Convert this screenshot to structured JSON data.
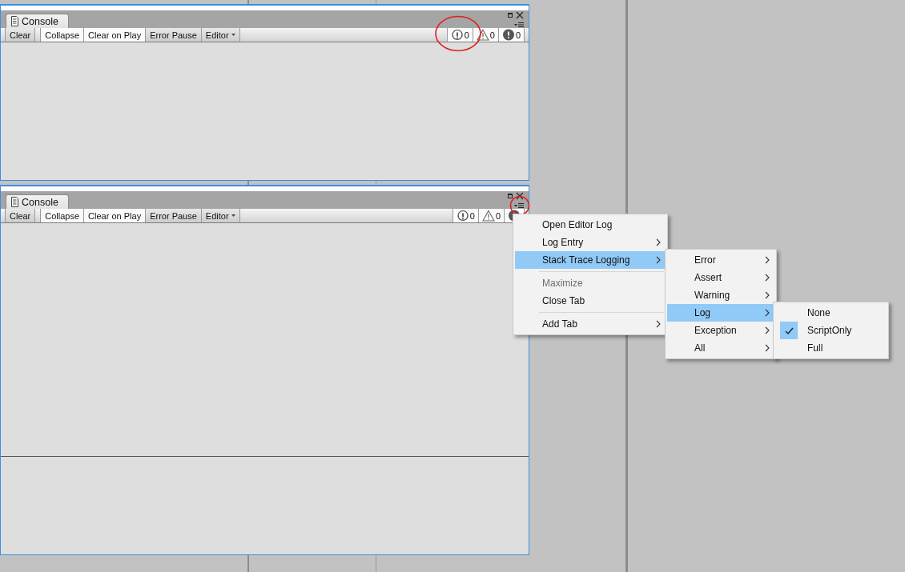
{
  "panels": [
    {
      "tab": "Console",
      "buttons": [
        {
          "label": "Clear",
          "light": false,
          "dropdown": false
        },
        {
          "label": "Collapse",
          "light": true,
          "dropdown": false
        },
        {
          "label": "Clear on Play",
          "light": true,
          "dropdown": false
        },
        {
          "label": "Error Pause",
          "light": false,
          "dropdown": false
        },
        {
          "label": "Editor",
          "light": false,
          "dropdown": true
        }
      ],
      "counters": [
        {
          "kind": "info",
          "count": "0",
          "on": true
        },
        {
          "kind": "warning",
          "count": "0",
          "on": true
        },
        {
          "kind": "error",
          "count": "0",
          "on": true
        }
      ],
      "split": false,
      "annotation": {
        "kind": "counters"
      }
    },
    {
      "tab": "Console",
      "buttons": [
        {
          "label": "Clear",
          "light": false,
          "dropdown": false
        },
        {
          "label": "Collapse",
          "light": true,
          "dropdown": false
        },
        {
          "label": "Clear on Play",
          "light": true,
          "dropdown": false
        },
        {
          "label": "Error Pause",
          "light": false,
          "dropdown": false
        },
        {
          "label": "Editor",
          "light": false,
          "dropdown": true
        }
      ],
      "counters": [
        {
          "kind": "info",
          "count": "0",
          "on": true
        },
        {
          "kind": "warning",
          "count": "0",
          "on": true
        },
        {
          "kind": "error",
          "on": true
        }
      ],
      "split": true,
      "annotation": {
        "kind": "menu"
      }
    }
  ],
  "menus": [
    {
      "items": [
        {
          "kind": "item",
          "label": "Open Editor Log",
          "submenu": false,
          "selected": false,
          "disabled": false
        },
        {
          "kind": "item",
          "label": "Log Entry",
          "submenu": true,
          "selected": false,
          "disabled": false
        },
        {
          "kind": "item",
          "label": "Stack Trace Logging",
          "submenu": true,
          "selected": true,
          "disabled": false
        },
        {
          "kind": "separator"
        },
        {
          "kind": "item",
          "label": "Maximize",
          "submenu": false,
          "selected": false,
          "disabled": true
        },
        {
          "kind": "item",
          "label": "Close Tab",
          "submenu": false,
          "selected": false,
          "disabled": false
        },
        {
          "kind": "separator"
        },
        {
          "kind": "item",
          "label": "Add Tab",
          "submenu": true,
          "selected": false,
          "disabled": false
        }
      ]
    },
    {
      "items": [
        {
          "kind": "item",
          "label": "Error",
          "submenu": true,
          "selected": false,
          "disabled": false
        },
        {
          "kind": "item",
          "label": "Assert",
          "submenu": true,
          "selected": false,
          "disabled": false
        },
        {
          "kind": "item",
          "label": "Warning",
          "submenu": true,
          "selected": false,
          "disabled": false
        },
        {
          "kind": "item",
          "label": "Log",
          "submenu": true,
          "selected": true,
          "disabled": false
        },
        {
          "kind": "item",
          "label": "Exception",
          "submenu": true,
          "selected": false,
          "disabled": false
        },
        {
          "kind": "item",
          "label": "All",
          "submenu": true,
          "selected": false,
          "disabled": false
        }
      ]
    },
    {
      "items": [
        {
          "kind": "item",
          "label": "None",
          "submenu": false,
          "selected": false,
          "disabled": false,
          "checked": false
        },
        {
          "kind": "item",
          "label": "ScriptOnly",
          "submenu": false,
          "selected": false,
          "disabled": false,
          "checked": true
        },
        {
          "kind": "item",
          "label": "Full",
          "submenu": false,
          "selected": false,
          "disabled": false,
          "checked": false
        }
      ]
    }
  ]
}
